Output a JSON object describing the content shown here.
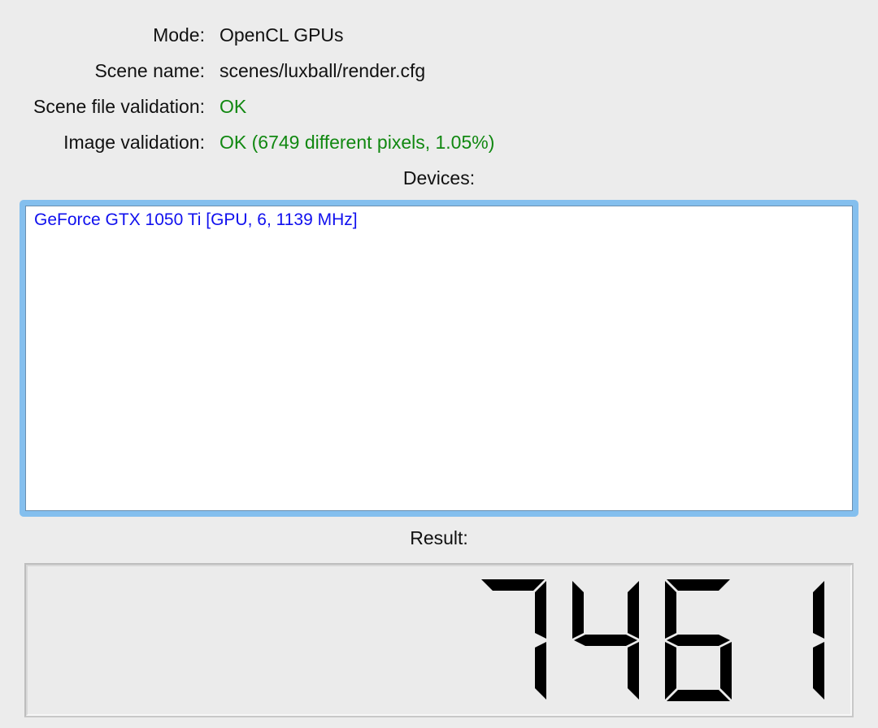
{
  "info": {
    "mode_label": "Mode:",
    "mode_value": "OpenCL GPUs",
    "scene_label": "Scene name:",
    "scene_value": "scenes/luxball/render.cfg",
    "scene_validation_label": "Scene file validation:",
    "scene_validation_value": "OK",
    "image_validation_label": "Image validation:",
    "image_validation_value": "OK (6749 different pixels, 1.05%)"
  },
  "devices": {
    "label": "Devices:",
    "items": [
      "GeForce GTX 1050 Ti [GPU, 6, 1139 MHz]"
    ]
  },
  "result": {
    "label": "Result:",
    "value": "7461"
  },
  "colors": {
    "ok": "#118811",
    "device_text": "#1010ee",
    "focus_ring": "#84bfee",
    "lcd_segment": "#000000"
  }
}
